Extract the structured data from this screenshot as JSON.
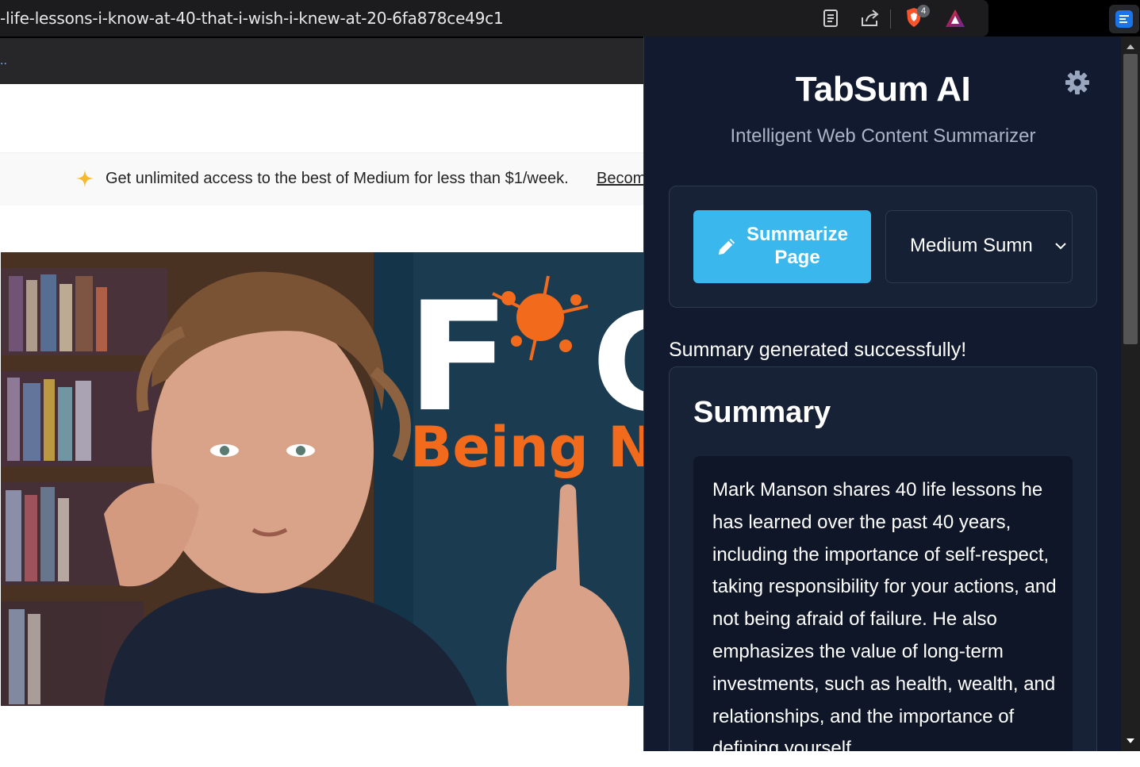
{
  "browser": {
    "url": "-life-lessons-i-know-at-40-that-i-wish-i-knew-at-20-6fa878ce49c1",
    "bookmarks_overflow": "..",
    "brave_badge_count": "4"
  },
  "medium": {
    "promo_text": "Get unlimited access to the best of Medium for less than $1/week.",
    "promo_link": "Becom",
    "hero_text_large": "F",
    "hero_text_o": "C",
    "hero_subtitle": "Being No"
  },
  "panel": {
    "title": "TabSum AI",
    "subtitle": "Intelligent Web Content Summarizer",
    "summarize_button": "Summarize Page",
    "mode_select_value": "Medium Sumn",
    "status": "Summary generated successfully!",
    "summary_heading": "Summary",
    "summary_text": "Mark Manson shares 40 life lessons he has learned over the past 40 years, including the importance of self-respect, taking responsibility for your actions, and not being afraid of failure. He also emphasizes the value of long-term investments, such as health, wealth, and relationships, and the importance of defining yourself"
  },
  "colors": {
    "panel_bg": "#111a2e",
    "button_accent": "#3ab8ee",
    "promo_star": "#f5b82e"
  }
}
